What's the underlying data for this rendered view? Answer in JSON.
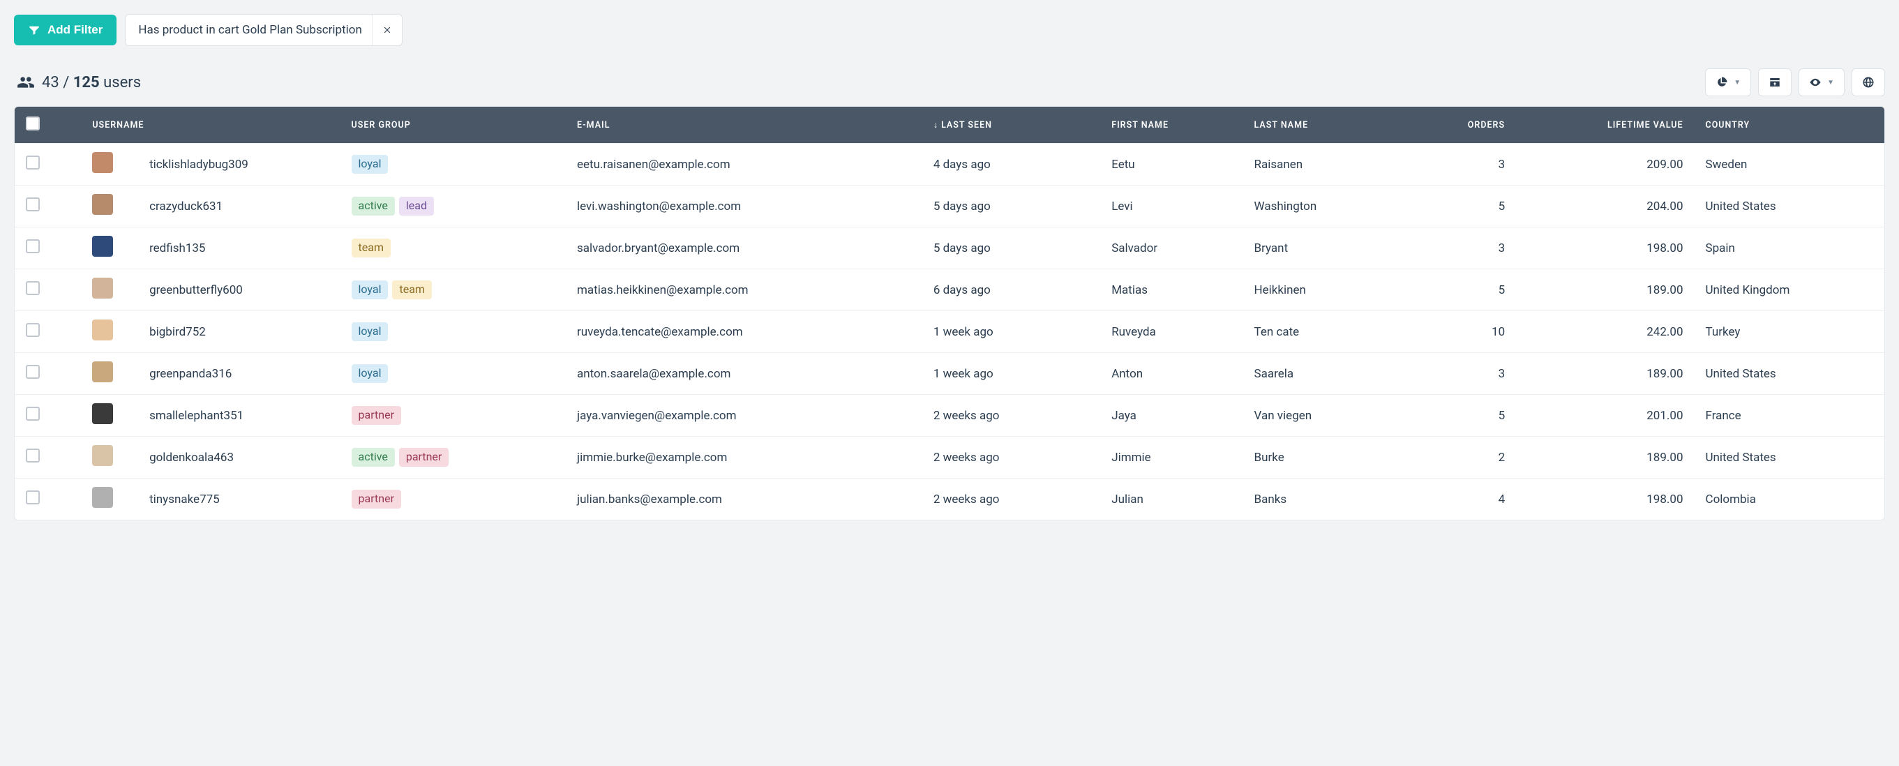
{
  "filters": {
    "add_label": "Add Filter",
    "chips": [
      {
        "label": "Has product in cart Gold Plan Subscription"
      }
    ]
  },
  "summary": {
    "filtered": "43",
    "separator": "/",
    "total": "125",
    "label": "users"
  },
  "table": {
    "headers": {
      "username": "USERNAME",
      "user_group": "USER GROUP",
      "email": "E-MAIL",
      "last_seen": "LAST SEEN",
      "last_seen_sort_arrow": "↓",
      "first_name": "FIRST NAME",
      "last_name": "LAST NAME",
      "orders": "ORDERS",
      "lifetime_value": "LIFETIME VALUE",
      "country": "COUNTRY"
    },
    "tag_colors": {
      "loyal": "tag-loyal",
      "active": "tag-active",
      "lead": "tag-lead",
      "team": "tag-team",
      "partner": "tag-partner"
    },
    "rows": [
      {
        "avatar_color": "#c38a6a",
        "username": "ticklishladybug309",
        "groups": [
          "loyal"
        ],
        "email": "eetu.raisanen@example.com",
        "last_seen": "4 days ago",
        "first_name": "Eetu",
        "last_name": "Raisanen",
        "orders": "3",
        "ltv": "209.00",
        "country": "Sweden"
      },
      {
        "avatar_color": "#b58b6b",
        "username": "crazyduck631",
        "groups": [
          "active",
          "lead"
        ],
        "email": "levi.washington@example.com",
        "last_seen": "5 days ago",
        "first_name": "Levi",
        "last_name": "Washington",
        "orders": "5",
        "ltv": "204.00",
        "country": "United States"
      },
      {
        "avatar_color": "#2e4a7a",
        "username": "redfish135",
        "groups": [
          "team"
        ],
        "email": "salvador.bryant@example.com",
        "last_seen": "5 days ago",
        "first_name": "Salvador",
        "last_name": "Bryant",
        "orders": "3",
        "ltv": "198.00",
        "country": "Spain"
      },
      {
        "avatar_color": "#d1b49a",
        "username": "greenbutterfly600",
        "groups": [
          "loyal",
          "team"
        ],
        "email": "matias.heikkinen@example.com",
        "last_seen": "6 days ago",
        "first_name": "Matias",
        "last_name": "Heikkinen",
        "orders": "5",
        "ltv": "189.00",
        "country": "United Kingdom"
      },
      {
        "avatar_color": "#e6c39a",
        "username": "bigbird752",
        "groups": [
          "loyal"
        ],
        "email": "ruveyda.tencate@example.com",
        "last_seen": "1 week ago",
        "first_name": "Ruveyda",
        "last_name": "Ten cate",
        "orders": "10",
        "ltv": "242.00",
        "country": "Turkey"
      },
      {
        "avatar_color": "#c9a87e",
        "username": "greenpanda316",
        "groups": [
          "loyal"
        ],
        "email": "anton.saarela@example.com",
        "last_seen": "1 week ago",
        "first_name": "Anton",
        "last_name": "Saarela",
        "orders": "3",
        "ltv": "189.00",
        "country": "United States"
      },
      {
        "avatar_color": "#3a3a3a",
        "username": "smallelephant351",
        "groups": [
          "partner"
        ],
        "email": "jaya.vanviegen@example.com",
        "last_seen": "2 weeks ago",
        "first_name": "Jaya",
        "last_name": "Van viegen",
        "orders": "5",
        "ltv": "201.00",
        "country": "France"
      },
      {
        "avatar_color": "#d9c4a8",
        "username": "goldenkoala463",
        "groups": [
          "active",
          "partner"
        ],
        "email": "jimmie.burke@example.com",
        "last_seen": "2 weeks ago",
        "first_name": "Jimmie",
        "last_name": "Burke",
        "orders": "2",
        "ltv": "189.00",
        "country": "United States"
      },
      {
        "avatar_color": "#b0b0b0",
        "username": "tinysnake775",
        "groups": [
          "partner"
        ],
        "email": "julian.banks@example.com",
        "last_seen": "2 weeks ago",
        "first_name": "Julian",
        "last_name": "Banks",
        "orders": "4",
        "ltv": "198.00",
        "country": "Colombia"
      }
    ]
  }
}
